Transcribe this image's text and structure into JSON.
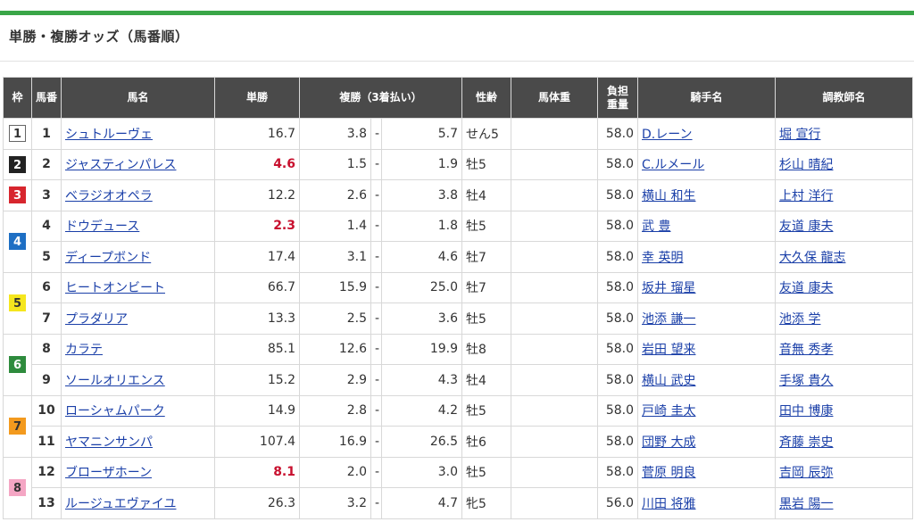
{
  "page": {
    "title": "単勝・複勝オッズ（馬番順）",
    "accent_color": "#3aa648"
  },
  "table": {
    "headers": {
      "waku": "枠",
      "umaban": "馬番",
      "horse": "馬名",
      "win": "単勝",
      "place": "複勝（3着払い）",
      "sex_age": "性齢",
      "body_weight": "馬体重",
      "burden_1": "負担",
      "burden_2": "重量",
      "jockey": "騎手名",
      "trainer": "調教師名"
    },
    "waku_colors": {
      "1": {
        "bg": "#ffffff",
        "fg": "#333333",
        "border": "#666666"
      },
      "2": {
        "bg": "#222222",
        "fg": "#ffffff",
        "border": "#222222"
      },
      "3": {
        "bg": "#d7262e",
        "fg": "#ffffff",
        "border": "#d7262e"
      },
      "4": {
        "bg": "#1e6fc4",
        "fg": "#ffffff",
        "border": "#1e6fc4"
      },
      "5": {
        "bg": "#f5e61e",
        "fg": "#333333",
        "border": "#f5e61e"
      },
      "6": {
        "bg": "#2e8b3d",
        "fg": "#ffffff",
        "border": "#2e8b3d"
      },
      "7": {
        "bg": "#f39a1e",
        "fg": "#333333",
        "border": "#f39a1e"
      },
      "8": {
        "bg": "#f4a6c4",
        "fg": "#333333",
        "border": "#f4a6c4"
      }
    },
    "favorite_color": "#c8102e",
    "rows": [
      {
        "waku": "1",
        "num": "1",
        "horse": "シュトルーヴェ",
        "win": "16.7",
        "fav": false,
        "pmin": "3.8",
        "pmax": "5.7",
        "sex": "せん5",
        "weight": "",
        "burden": "58.0",
        "jockey": "D.レーン",
        "trainer": "堀 宣行"
      },
      {
        "waku": "2",
        "num": "2",
        "horse": "ジャスティンパレス",
        "win": "4.6",
        "fav": true,
        "pmin": "1.5",
        "pmax": "1.9",
        "sex": "牡5",
        "weight": "",
        "burden": "58.0",
        "jockey": "C.ルメール",
        "trainer": "杉山 晴紀"
      },
      {
        "waku": "3",
        "num": "3",
        "horse": "ベラジオオペラ",
        "win": "12.2",
        "fav": false,
        "pmin": "2.6",
        "pmax": "3.8",
        "sex": "牡4",
        "weight": "",
        "burden": "58.0",
        "jockey": "横山 和生",
        "trainer": "上村 洋行"
      },
      {
        "waku": "4",
        "num": "4",
        "horse": "ドウデュース",
        "win": "2.3",
        "fav": true,
        "pmin": "1.4",
        "pmax": "1.8",
        "sex": "牡5",
        "weight": "",
        "burden": "58.0",
        "jockey": "武 豊",
        "trainer": "友道 康夫"
      },
      {
        "waku": "",
        "num": "5",
        "horse": "ディープボンド",
        "win": "17.4",
        "fav": false,
        "pmin": "3.1",
        "pmax": "4.6",
        "sex": "牡7",
        "weight": "",
        "burden": "58.0",
        "jockey": "幸 英明",
        "trainer": "大久保 龍志"
      },
      {
        "waku": "5",
        "num": "6",
        "horse": "ヒートオンビート",
        "win": "66.7",
        "fav": false,
        "pmin": "15.9",
        "pmax": "25.0",
        "sex": "牡7",
        "weight": "",
        "burden": "58.0",
        "jockey": "坂井 瑠星",
        "trainer": "友道 康夫"
      },
      {
        "waku": "",
        "num": "7",
        "horse": "プラダリア",
        "win": "13.3",
        "fav": false,
        "pmin": "2.5",
        "pmax": "3.6",
        "sex": "牡5",
        "weight": "",
        "burden": "58.0",
        "jockey": "池添 謙一",
        "trainer": "池添 学"
      },
      {
        "waku": "6",
        "num": "8",
        "horse": "カラテ",
        "win": "85.1",
        "fav": false,
        "pmin": "12.6",
        "pmax": "19.9",
        "sex": "牡8",
        "weight": "",
        "burden": "58.0",
        "jockey": "岩田 望来",
        "trainer": "音無 秀孝"
      },
      {
        "waku": "",
        "num": "9",
        "horse": "ソールオリエンス",
        "win": "15.2",
        "fav": false,
        "pmin": "2.9",
        "pmax": "4.3",
        "sex": "牡4",
        "weight": "",
        "burden": "58.0",
        "jockey": "横山 武史",
        "trainer": "手塚 貴久"
      },
      {
        "waku": "7",
        "num": "10",
        "horse": "ローシャムパーク",
        "win": "14.9",
        "fav": false,
        "pmin": "2.8",
        "pmax": "4.2",
        "sex": "牡5",
        "weight": "",
        "burden": "58.0",
        "jockey": "戸崎 圭太",
        "trainer": "田中 博康"
      },
      {
        "waku": "",
        "num": "11",
        "horse": "ヤマニンサンパ",
        "win": "107.4",
        "fav": false,
        "pmin": "16.9",
        "pmax": "26.5",
        "sex": "牡6",
        "weight": "",
        "burden": "58.0",
        "jockey": "団野 大成",
        "trainer": "斉藤 崇史"
      },
      {
        "waku": "8",
        "num": "12",
        "horse": "ブローザホーン",
        "win": "8.1",
        "fav": true,
        "pmin": "2.0",
        "pmax": "3.0",
        "sex": "牡5",
        "weight": "",
        "burden": "58.0",
        "jockey": "菅原 明良",
        "trainer": "吉岡 辰弥"
      },
      {
        "waku": "",
        "num": "13",
        "horse": "ルージュエヴァイユ",
        "win": "26.3",
        "fav": false,
        "pmin": "3.2",
        "pmax": "4.7",
        "sex": "牝5",
        "weight": "",
        "burden": "56.0",
        "jockey": "川田 将雅",
        "trainer": "黒岩 陽一"
      }
    ]
  }
}
